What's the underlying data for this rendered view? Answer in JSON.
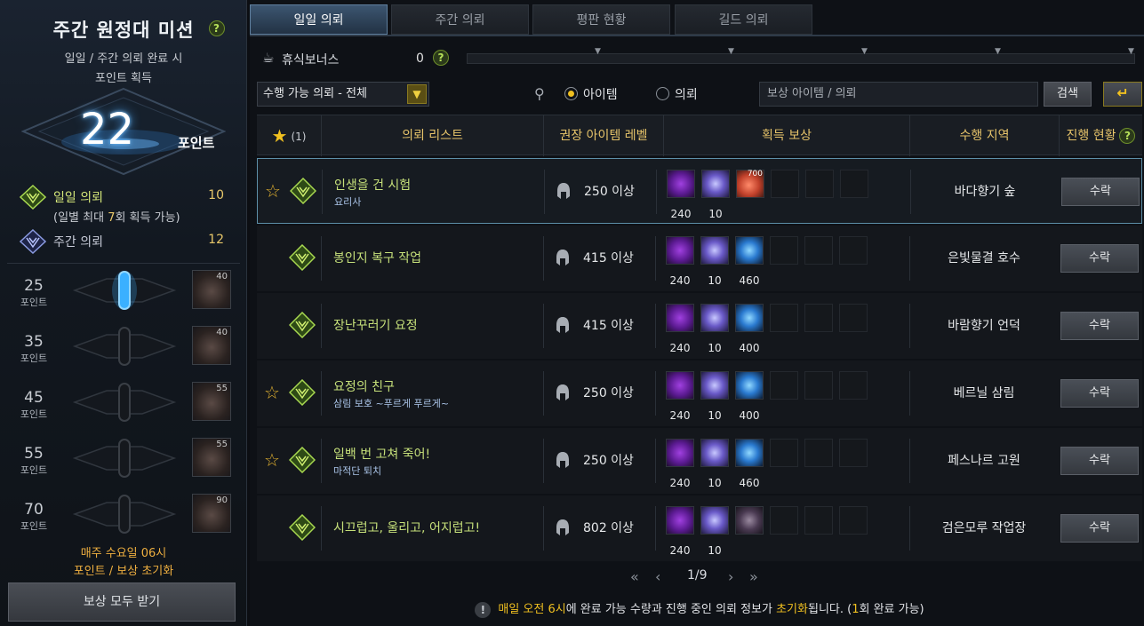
{
  "left": {
    "title": "주간 원정대 미션",
    "help": "?",
    "subtitle_1": "일일 / 주간 의뢰 완료 시",
    "subtitle_2": "포인트 획득",
    "points": "22",
    "points_label": "포인트",
    "daily_label": "일일 의뢰",
    "daily_value": "10",
    "daily_note_prefix": "(일별 최대 ",
    "daily_note_num": "7",
    "daily_note_suffix": "회 획득 가능)",
    "weekly_label": "주간 의뢰",
    "weekly_value": "12",
    "tiers": [
      {
        "points": "25",
        "unit": "포인트",
        "reward_count": "40",
        "active": true
      },
      {
        "points": "35",
        "unit": "포인트",
        "reward_count": "40",
        "active": false
      },
      {
        "points": "45",
        "unit": "포인트",
        "reward_count": "55",
        "active": false
      },
      {
        "points": "55",
        "unit": "포인트",
        "reward_count": "55",
        "active": false
      },
      {
        "points": "70",
        "unit": "포인트",
        "reward_count": "90",
        "active": false
      }
    ],
    "reset_line_1": "매주 수요일 06시",
    "reset_line_2": "포인트 / 보상 초기화",
    "claim_all": "보상 모두 받기"
  },
  "tabs": [
    "일일 의뢰",
    "주간 의뢰",
    "평판 현황",
    "길드 의뢰"
  ],
  "rest": {
    "icon": "cup-icon",
    "label": "휴식보너스",
    "value": "0",
    "help": "?"
  },
  "toolbar": {
    "filter_value": "수행 가능 의뢰 - 전체",
    "radio_item": "아이템",
    "radio_quest": "의뢰",
    "search_placeholder": "보상 아이템 / 의뢰",
    "search_button": "검색",
    "return_icon": "↵"
  },
  "table": {
    "fav_count": "(1)",
    "headers": [
      "의뢰 리스트",
      "권장 아이템 레벨",
      "획득 보상",
      "수행 지역",
      "진행 현황"
    ],
    "rows": [
      {
        "fav": true,
        "name": "인생을 건 시험",
        "sub": "요리사",
        "level": "250 이상",
        "rewards": [
          {
            "type": "a",
            "count": "240"
          },
          {
            "type": "b",
            "count": "10"
          },
          {
            "type": "d",
            "count": "",
            "badge": "700"
          }
        ],
        "region": "바다향기 숲",
        "action": "수락",
        "selected": true
      },
      {
        "fav": false,
        "name": "봉인지 복구 작업",
        "sub": "",
        "level": "415 이상",
        "rewards": [
          {
            "type": "a",
            "count": "240"
          },
          {
            "type": "b",
            "count": "10"
          },
          {
            "type": "c",
            "count": "460"
          }
        ],
        "region": "은빛물결 호수",
        "action": "수락",
        "selected": false
      },
      {
        "fav": false,
        "name": "장난꾸러기 요정",
        "sub": "",
        "level": "415 이상",
        "rewards": [
          {
            "type": "a",
            "count": "240"
          },
          {
            "type": "b",
            "count": "10"
          },
          {
            "type": "c",
            "count": "400"
          }
        ],
        "region": "바람향기 언덕",
        "action": "수락",
        "selected": false
      },
      {
        "fav": true,
        "name": "요정의 친구",
        "sub": "삼림 보호 ~푸르게 푸르게~",
        "level": "250 이상",
        "rewards": [
          {
            "type": "a",
            "count": "240"
          },
          {
            "type": "b",
            "count": "10"
          },
          {
            "type": "c",
            "count": "400"
          }
        ],
        "region": "베르닐 삼림",
        "action": "수락",
        "selected": false
      },
      {
        "fav": true,
        "name": "일백 번 고쳐 죽어!",
        "sub": "마적단 퇴치",
        "level": "250 이상",
        "rewards": [
          {
            "type": "a",
            "count": "240"
          },
          {
            "type": "b",
            "count": "10"
          },
          {
            "type": "c",
            "count": "460"
          }
        ],
        "region": "페스나르 고원",
        "action": "수락",
        "selected": false
      },
      {
        "fav": false,
        "name": "시끄럽고, 울리고, 어지럽고!",
        "sub": "",
        "level": "802 이상",
        "rewards": [
          {
            "type": "a",
            "count": "240"
          },
          {
            "type": "b",
            "count": "10"
          },
          {
            "type": "e",
            "count": ""
          }
        ],
        "region": "검은모루 작업장",
        "action": "수락",
        "selected": false
      }
    ]
  },
  "pager": {
    "first": "«",
    "prev": "‹",
    "current": "1/9",
    "next": "›",
    "last": "»"
  },
  "footer": {
    "p1": "매일 오전 6시",
    "p2": "에 완료 가능 수량과 진행 중인 의뢰 정보가 ",
    "p3": "초기화",
    "p4": "됩니다. (",
    "p5": "1",
    "p6": "회 완료 가능)"
  }
}
